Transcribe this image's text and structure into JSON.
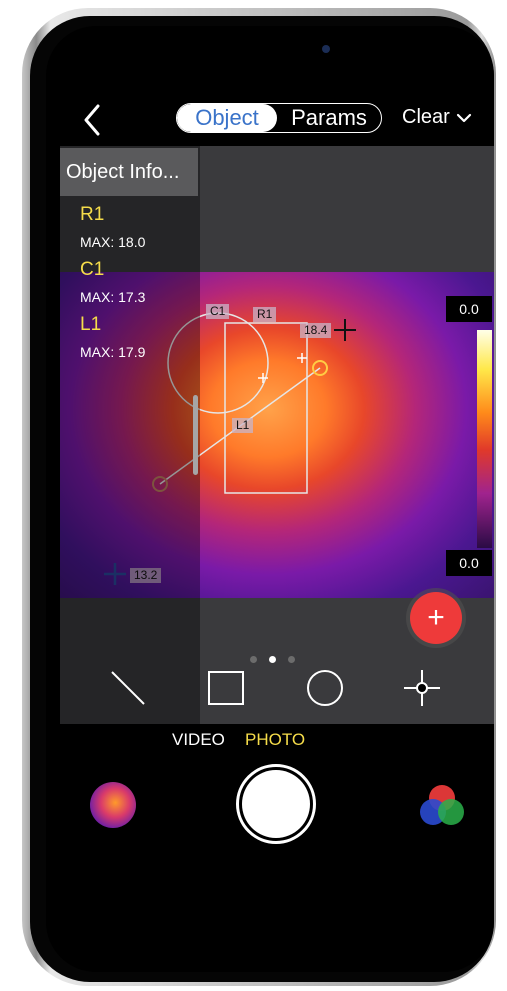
{
  "top_bar": {
    "tabs": [
      {
        "label": "Object",
        "active": true
      },
      {
        "label": "Params",
        "active": false
      }
    ],
    "clear_label": "Clear"
  },
  "object_info": {
    "header": "Object Info...",
    "objects": [
      {
        "name": "R1",
        "value": "MAX: 18.0"
      },
      {
        "name": "C1",
        "value": "MAX: 17.3"
      },
      {
        "name": "L1",
        "value": "MAX: 17.9"
      }
    ]
  },
  "thermal_view": {
    "shape_labels": {
      "circle": "C1",
      "rect": "R1",
      "line": "L1"
    },
    "point_temps": {
      "hot": "18.4",
      "cold": "13.2"
    },
    "scale": {
      "max": "0.0",
      "min": "0.0"
    }
  },
  "toolbar": {
    "page_dots": 3,
    "active_dot": 1,
    "tools": [
      "line-tool",
      "rectangle-tool",
      "circle-tool",
      "point-tool"
    ]
  },
  "capture": {
    "modes": [
      {
        "label": "VIDEO",
        "active": false
      },
      {
        "label": "PHOTO",
        "active": true
      }
    ]
  },
  "colors": {
    "accent_blue": "#3a73c9",
    "highlight_yellow": "#f6dd4a",
    "fab_red": "#ee3a3a"
  }
}
